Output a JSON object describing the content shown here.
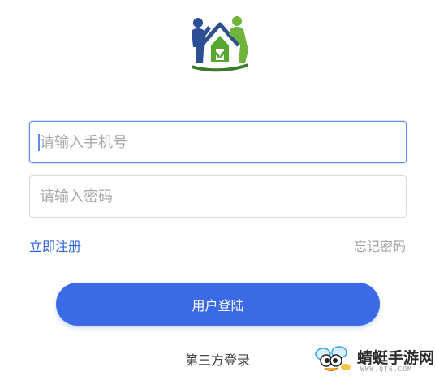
{
  "app": {
    "logo": "family-house-logo-icon"
  },
  "form": {
    "phone_placeholder": "请输入手机号",
    "phone_value": "",
    "password_placeholder": "请输入密码",
    "password_value": ""
  },
  "links": {
    "register": "立即注册",
    "forgot": "忘记密码"
  },
  "buttons": {
    "login": "用户登陆"
  },
  "third_party": {
    "label": "第三方登录"
  },
  "watermark": {
    "icon": "dragonfly-mascot-icon",
    "text": "蜻蜓手游网",
    "url": "WWW.QT6.COM"
  },
  "colors": {
    "accent": "#3b6ae6",
    "link": "#3066d8",
    "focus_border": "#5b8def",
    "muted_text": "#a3a3a3"
  }
}
